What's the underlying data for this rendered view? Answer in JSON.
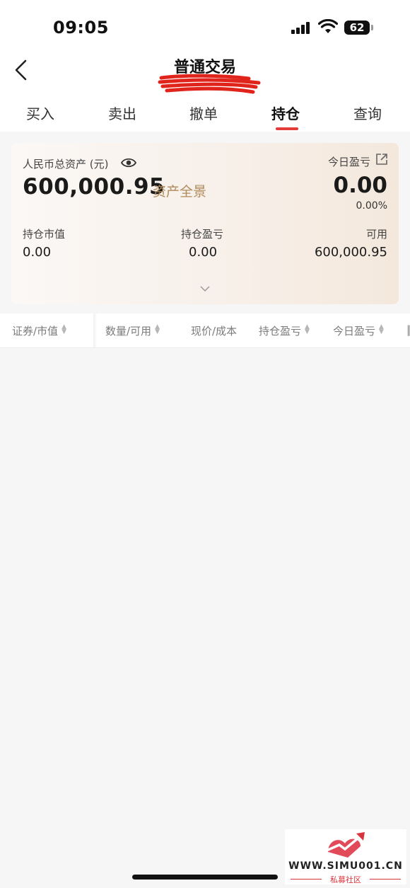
{
  "status_bar": {
    "time": "09:05",
    "battery": "62"
  },
  "nav": {
    "title": "普通交易",
    "back_icon": "chevron-left-icon"
  },
  "tabs": [
    {
      "label": "买入",
      "active": false
    },
    {
      "label": "卖出",
      "active": false
    },
    {
      "label": "撤单",
      "active": false
    },
    {
      "label": "持仓",
      "active": true
    },
    {
      "label": "查询",
      "active": false
    }
  ],
  "assets": {
    "total_label": "人民币总资产 (元)",
    "total_value": "600,000.95",
    "overview_link": "资产全景",
    "today_pnl_label": "今日盈亏",
    "today_pnl_value": "0.00",
    "today_pnl_pct": "0.00%",
    "stats": [
      {
        "label": "持仓市值",
        "value": "0.00"
      },
      {
        "label": "持仓盈亏",
        "value": "0.00"
      },
      {
        "label": "可用",
        "value": "600,000.95"
      }
    ]
  },
  "table_headers": [
    {
      "label": "证券/市值",
      "sortable": true
    },
    {
      "label": "数量/可用",
      "sortable": true
    },
    {
      "label": "现价/成本",
      "sortable": false
    },
    {
      "label": "持仓盈亏",
      "sortable": true
    },
    {
      "label": "今日盈亏",
      "sortable": true
    }
  ],
  "watermark": {
    "site": "WWW.SIMU001.CN",
    "name": "私募社区"
  },
  "colors": {
    "accent": "#e33a3a",
    "gold": "#b08a5a",
    "background": "#f6f6f6"
  }
}
